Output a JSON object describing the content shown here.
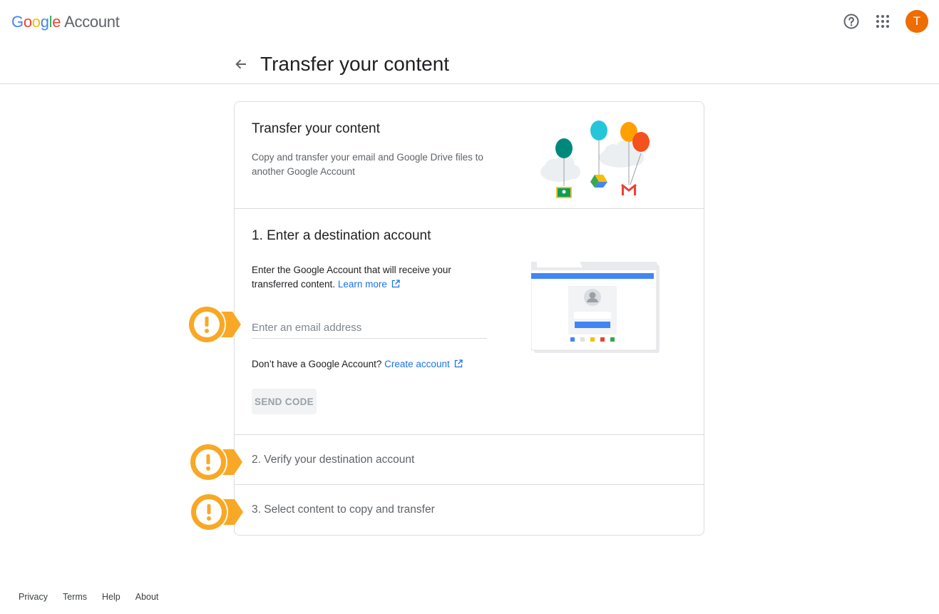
{
  "header": {
    "logo_letters": [
      "G",
      "o",
      "o",
      "g",
      "l",
      "e"
    ],
    "logo_product": "Account",
    "help_icon": "help-circle-icon",
    "apps_icon": "apps-grid-icon",
    "avatar_letter": "T",
    "avatar_color": "#ef6c00"
  },
  "page": {
    "title": "Transfer your content",
    "back_icon": "arrow-back-icon"
  },
  "intro": {
    "title": "Transfer your content",
    "description": "Copy and transfer your email and Google Drive files to another Google Account"
  },
  "step1": {
    "title": "1. Enter a destination account",
    "description": "Enter the Google Account that will receive your transferred content.",
    "learn_more": "Learn more",
    "email_placeholder": "Enter an email address",
    "email_value": "",
    "no_account_text": "Don’t have a Google Account?",
    "create_account": "Create account",
    "send_code": "SEND CODE"
  },
  "step2": {
    "title": "2. Verify your destination account"
  },
  "step3": {
    "title": "3. Select content to copy and transfer"
  },
  "footer": {
    "links": [
      "Privacy",
      "Terms",
      "Help",
      "About"
    ]
  },
  "colors": {
    "accent": "#1a73e8",
    "marker": "#f9a825",
    "divider": "#dadce0"
  }
}
